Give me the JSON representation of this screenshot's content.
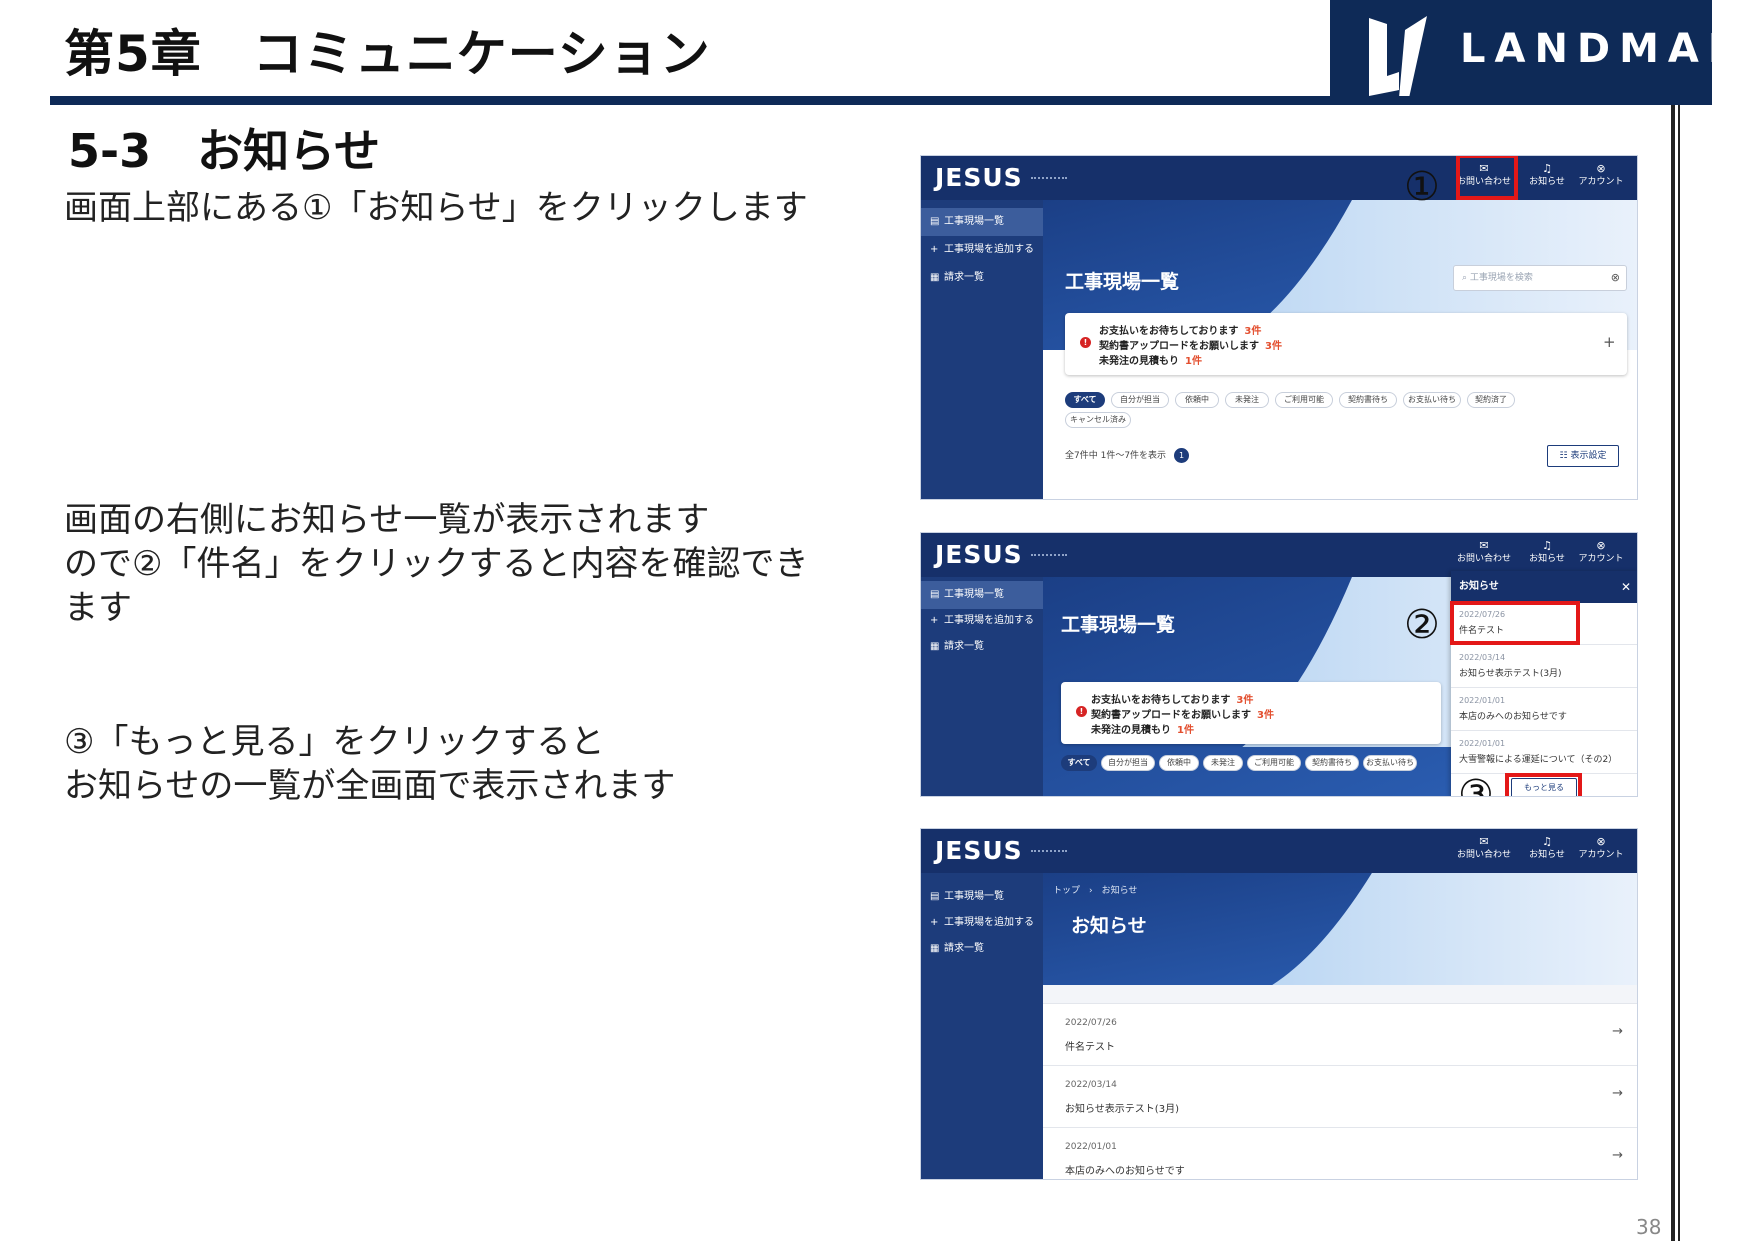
{
  "header": {
    "chapter_title": "第5章　コミュニケーション",
    "logo_text": "LANDMARK",
    "section_title": "5-3　お知らせ"
  },
  "instructions": {
    "step1": "画面上部にある①「お知らせ」をクリックします",
    "step2": "画面の右側にお知らせ一覧が表示されます\nので②「件名」をクリックすると内容を確認でき\nます",
    "step3": "③「もっと見る」をクリックすると\nお知らせの一覧が全画面で表示されます"
  },
  "markers": {
    "m1": "①",
    "m2": "②",
    "m3": "③"
  },
  "page_number": "38",
  "app": {
    "logo": "JESUS",
    "nav": {
      "contact": "お問い合わせ",
      "notice": "お知らせ",
      "account": "アカウント"
    },
    "icons": {
      "contact": "✉",
      "notice": "♫",
      "account": "⊗"
    },
    "sidebar": [
      {
        "icon": "▤",
        "label": "工事現場一覧"
      },
      {
        "icon": "+",
        "label": "工事現場を追加する"
      },
      {
        "icon": "▦",
        "label": "請求一覧"
      }
    ],
    "site_list_title": "工事現場一覧",
    "search_placeholder": "工事現場を検索",
    "alerts": [
      {
        "text": "お支払いをお待ちしております",
        "count": "3件"
      },
      {
        "text": "契約書アップロードをお願いします",
        "count": "3件"
      },
      {
        "text": "未発注の見積もり",
        "count": "1件"
      }
    ],
    "filters": [
      "すべて",
      "自分が担当",
      "依頼中",
      "未発注",
      "ご利用可能",
      "契約書待ち",
      "お支払い待ち",
      "契約済了",
      "キャンセル済み"
    ],
    "count_text": "全7件中 1件〜7件を表示",
    "count_badge": "1",
    "display_settings": "☷ 表示設定",
    "panel_title": "お知らせ",
    "notices": [
      {
        "date": "2022/07/26",
        "title": "件名テスト"
      },
      {
        "date": "2022/03/14",
        "title": "お知らせ表示テスト(3月)"
      },
      {
        "date": "2022/01/01",
        "title": "本店のみへのお知らせです"
      },
      {
        "date": "2022/01/01",
        "title": "大雪警報による運延について（その2）"
      }
    ],
    "more_button": "もっと見る",
    "breadcrumb": "トップ　›　お知らせ",
    "notice_page_title": "お知らせ"
  }
}
